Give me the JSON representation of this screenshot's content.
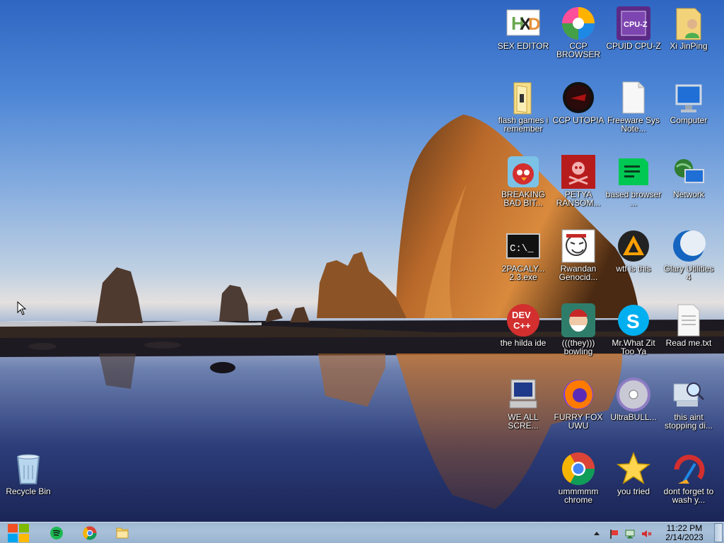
{
  "desktop": {
    "icons": [
      {
        "label": "SEX EDITOR",
        "icon": "hxd-hex-editor-icon"
      },
      {
        "label": "CCP BROWSER",
        "icon": "swirl-browser-icon"
      },
      {
        "label": "CPUID CPU-Z",
        "icon": "cpu-z-icon"
      },
      {
        "label": "Xi JinPing",
        "icon": "user-folder-icon"
      },
      {
        "label": "flash games i remember",
        "icon": "folder-icon"
      },
      {
        "label": "CCP UTOPIA",
        "icon": "dark-disc-icon"
      },
      {
        "label": "Freeware Sys Note...",
        "icon": "document-icon"
      },
      {
        "label": "Computer",
        "icon": "computer-monitor-icon"
      },
      {
        "label": "BREAKING BAD BIT...",
        "icon": "angry-bird-icon"
      },
      {
        "label": "PETYA RANSOM...",
        "icon": "skull-crossbones-icon"
      },
      {
        "label": "based browser ...",
        "icon": "green-document-icon"
      },
      {
        "label": "Network",
        "icon": "network-globe-icon"
      },
      {
        "label": "2PACALY... 2.3.exe",
        "icon": "command-prompt-icon"
      },
      {
        "label": "Rwandan Genocid...",
        "icon": "meme-face-icon"
      },
      {
        "label": "wtf is this",
        "icon": "aimp-triangle-icon"
      },
      {
        "label": "Glary Utilities 4",
        "icon": "crescent-icon"
      },
      {
        "label": "the hilda ide",
        "icon": "devcpp-icon"
      },
      {
        "label": "(((they))) bowling",
        "icon": "santa-game-icon"
      },
      {
        "label": "Mr.What Zit Too Ya",
        "icon": "skype-icon"
      },
      {
        "label": "Read me.txt",
        "icon": "text-file-icon"
      },
      {
        "label": "WE ALL SCRE...",
        "icon": "retro-computer-icon"
      },
      {
        "label": "FURRY FOX UWU",
        "icon": "firefox-icon"
      },
      {
        "label": "UltraBULL...",
        "icon": "optical-disc-icon"
      },
      {
        "label": "this aint stopping di...",
        "icon": "search-computer-icon"
      },
      {
        "label": "Recycle Bin",
        "icon": "recycle-bin-icon"
      },
      {
        "label": "ummmmm chrome",
        "icon": "chrome-icon"
      },
      {
        "label": "you tried",
        "icon": "gold-star-icon"
      },
      {
        "label": "dont forget to wash y...",
        "icon": "ccleaner-broom-icon"
      }
    ]
  },
  "taskbar": {
    "start_icon": "windows-logo-icon",
    "pinned": [
      {
        "name": "spotify",
        "icon": "spotify-icon"
      },
      {
        "name": "chrome",
        "icon": "chrome-icon"
      },
      {
        "name": "file-explorer",
        "icon": "folder-icon"
      }
    ],
    "tray": {
      "icons": [
        "tray-overflow-icon",
        "action-center-flag-icon",
        "network-icon",
        "volume-muted-icon"
      ],
      "time": "11:22 PM",
      "date": "2/14/2023"
    }
  },
  "colors": {
    "taskbar": "#a9c0d9",
    "sky_top": "#2f66c2",
    "label_text": "#ffffff"
  }
}
